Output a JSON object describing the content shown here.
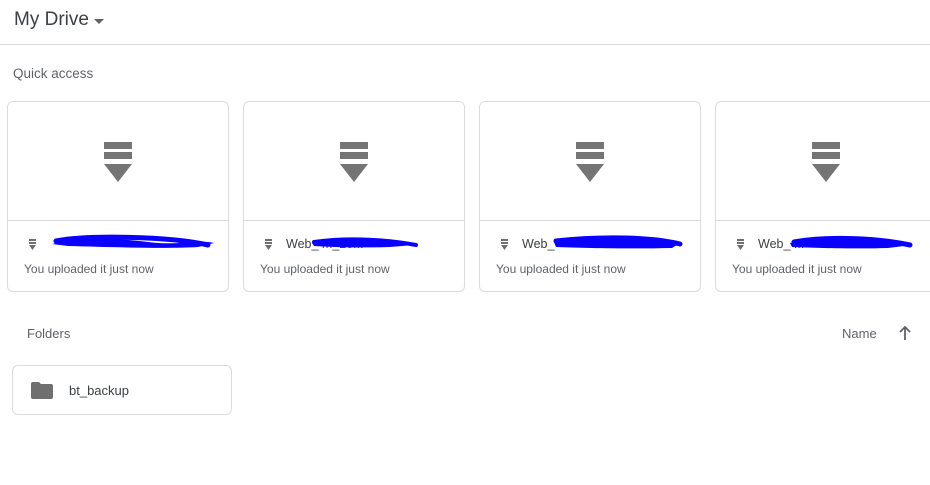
{
  "header": {
    "title": "My Drive"
  },
  "quick_access": {
    "label": "Quick access",
    "cards": [
      {
        "name": "",
        "subtitle": "You uploaded it just now",
        "icon": "stacked-file-icon"
      },
      {
        "name": "Web_                 m_20...",
        "subtitle": "You uploaded it just now",
        "icon": "stacked-file-icon"
      },
      {
        "name": "Web_",
        "subtitle": "You uploaded it just now",
        "icon": "stacked-file-icon"
      },
      {
        "name": "Web_                          ...",
        "subtitle": "You uploaded it just now",
        "icon": "stacked-file-icon"
      }
    ]
  },
  "folders": {
    "label": "Folders",
    "sort_label": "Name",
    "sort_direction": "ascending",
    "items": [
      {
        "name": "bt_backup",
        "icon": "folder-icon"
      }
    ]
  },
  "colors": {
    "redaction": "#0a00ff",
    "icon_gray": "#737373",
    "border": "#dadce0"
  }
}
